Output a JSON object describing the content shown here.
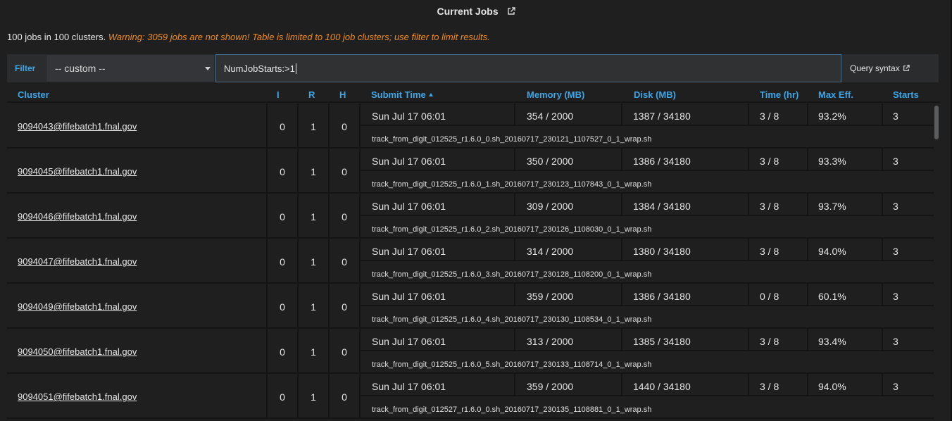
{
  "header": {
    "title": "Current Jobs",
    "summary_text": "100 jobs in 100 clusters.",
    "warning_text": "Warning: 3059 jobs are not shown! Table is limited to 100 job clusters; use filter to limit results."
  },
  "filter": {
    "label": "Filter",
    "selected_preset": "-- custom --",
    "query_value": "NumJobStarts:>1",
    "query_syntax_label": "Query syntax"
  },
  "columns": {
    "cluster": "Cluster",
    "i": "I",
    "r": "R",
    "h": "H",
    "submit_time": "Submit Time",
    "memory": "Memory (MB)",
    "disk": "Disk (MB)",
    "time": "Time (hr)",
    "max_eff": "Max Eff.",
    "starts": "Starts"
  },
  "rows": [
    {
      "cluster": "9094043@fifebatch1.fnal.gov",
      "i": "0",
      "r": "1",
      "h": "0",
      "submit": "Sun Jul 17 06:01",
      "memory": "354 / 2000",
      "disk": "1387 / 34180",
      "time": "3 / 8",
      "eff": "93.2%",
      "starts": "3",
      "cmd": "track_from_digit_012525_r1.6.0_0.sh_20160717_230121_1107527_0_1_wrap.sh"
    },
    {
      "cluster": "9094045@fifebatch1.fnal.gov",
      "i": "0",
      "r": "1",
      "h": "0",
      "submit": "Sun Jul 17 06:01",
      "memory": "350 / 2000",
      "disk": "1386 / 34180",
      "time": "3 / 8",
      "eff": "93.3%",
      "starts": "3",
      "cmd": "track_from_digit_012525_r1.6.0_1.sh_20160717_230123_1107843_0_1_wrap.sh"
    },
    {
      "cluster": "9094046@fifebatch1.fnal.gov",
      "i": "0",
      "r": "1",
      "h": "0",
      "submit": "Sun Jul 17 06:01",
      "memory": "309 / 2000",
      "disk": "1384 / 34180",
      "time": "3 / 8",
      "eff": "93.7%",
      "starts": "3",
      "cmd": "track_from_digit_012525_r1.6.0_2.sh_20160717_230126_1108030_0_1_wrap.sh"
    },
    {
      "cluster": "9094047@fifebatch1.fnal.gov",
      "i": "0",
      "r": "1",
      "h": "0",
      "submit": "Sun Jul 17 06:01",
      "memory": "314 / 2000",
      "disk": "1380 / 34180",
      "time": "3 / 8",
      "eff": "94.0%",
      "starts": "3",
      "cmd": "track_from_digit_012525_r1.6.0_3.sh_20160717_230128_1108200_0_1_wrap.sh"
    },
    {
      "cluster": "9094049@fifebatch1.fnal.gov",
      "i": "0",
      "r": "1",
      "h": "0",
      "submit": "Sun Jul 17 06:01",
      "memory": "359 / 2000",
      "disk": "1386 / 34180",
      "time": "0 / 8",
      "eff": "60.1%",
      "starts": "3",
      "cmd": "track_from_digit_012525_r1.6.0_4.sh_20160717_230130_1108534_0_1_wrap.sh"
    },
    {
      "cluster": "9094050@fifebatch1.fnal.gov",
      "i": "0",
      "r": "1",
      "h": "0",
      "submit": "Sun Jul 17 06:01",
      "memory": "313 / 2000",
      "disk": "1385 / 34180",
      "time": "3 / 8",
      "eff": "93.4%",
      "starts": "3",
      "cmd": "track_from_digit_012525_r1.6.0_5.sh_20160717_230133_1108714_0_1_wrap.sh"
    },
    {
      "cluster": "9094051@fifebatch1.fnal.gov",
      "i": "0",
      "r": "1",
      "h": "0",
      "submit": "Sun Jul 17 06:01",
      "memory": "359 / 2000",
      "disk": "1440 / 34180",
      "time": "3 / 8",
      "eff": "94.0%",
      "starts": "3",
      "cmd": "track_from_digit_012527_r1.6.0_0.sh_20160717_230135_1108881_0_1_wrap.sh"
    }
  ],
  "colors": {
    "accent": "#3ea6e6",
    "warning": "#f08c1e",
    "background": "#1f1f20"
  }
}
